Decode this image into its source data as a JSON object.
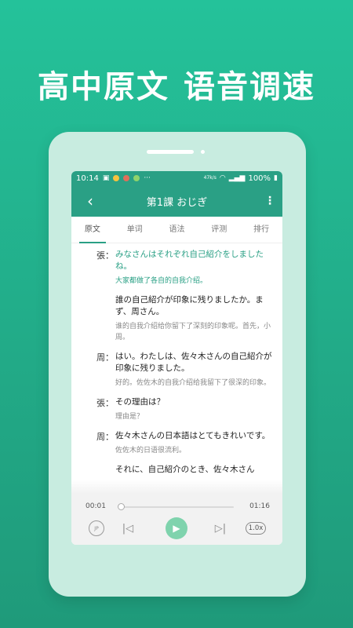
{
  "promo": {
    "headline_part1": "高中原文",
    "headline_part2_a": "语音",
    "headline_part2_b": "调速",
    "accent_color": "#f8a52a"
  },
  "statusbar": {
    "time": "10:14",
    "speed": "47k/s",
    "battery": "100%"
  },
  "appbar": {
    "title": "第1課 おじぎ",
    "back_icon": "chevron-left-icon",
    "more_icon": "more-vertical-icon"
  },
  "tabs": [
    {
      "label": "原文",
      "active": true
    },
    {
      "label": "单词",
      "active": false
    },
    {
      "label": "语法",
      "active": false
    },
    {
      "label": "评测",
      "active": false
    },
    {
      "label": "排行",
      "active": false
    }
  ],
  "dialogue": [
    {
      "speaker": "張：",
      "jp": "みなさんはそれぞれ自己紹介をしましたね。",
      "cn": "大家都做了各自的自我介绍。",
      "highlight": true
    },
    {
      "speaker": "",
      "jp": "誰の自己紹介が印象に残りましたか。まず、周さん。",
      "cn": "谁的自我介绍给你留下了深刻的印象呢。首先，小周。",
      "highlight": false
    },
    {
      "speaker": "周：",
      "jp": "はい。わたしは、佐々木さんの自己紹介が印象に残りました。",
      "cn": "好的。佐佐木的自我介绍给我留下了很深的印象。",
      "highlight": false
    },
    {
      "speaker": "張：",
      "jp": "その理由は？",
      "cn": "理由是？",
      "highlight": false
    },
    {
      "speaker": "周：",
      "jp": "佐々木さんの日本語はとてもきれいです。",
      "cn": "佐佐木的日语很流利。",
      "highlight": false
    },
    {
      "speaker": "",
      "jp": "それに、自己紹介のとき、佐々木さん",
      "cn": "",
      "highlight": false
    }
  ],
  "player": {
    "current_time": "00:01",
    "total_time": "01:16",
    "progress": 0.01,
    "speed": "1.0x",
    "jp_toggle": "JP",
    "accent_color": "#2aa085"
  }
}
